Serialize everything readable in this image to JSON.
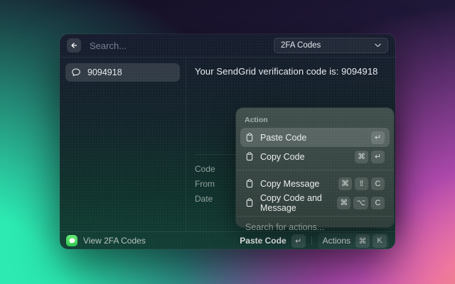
{
  "topbar": {
    "search_placeholder": "Search...",
    "dropdown_label": "2FA Codes"
  },
  "sidebar": {
    "items": [
      {
        "icon": "chat-bubble-icon",
        "label": "9094918",
        "selected": true
      }
    ]
  },
  "detail": {
    "message": "Your SendGrid verification code is: 9094918",
    "metadata_labels": [
      "Code",
      "From",
      "Date"
    ]
  },
  "action_menu": {
    "section_title": "Action",
    "items": [
      {
        "icon": "clipboard-icon",
        "label": "Paste Code",
        "keys": [
          "↵"
        ],
        "selected": true
      },
      {
        "icon": "clipboard-icon",
        "label": "Copy Code",
        "keys": [
          "⌘",
          "↵"
        ],
        "selected": false
      },
      {
        "icon": "clipboard-icon",
        "label": "Copy Message",
        "keys": [
          "⌘",
          "⇧",
          "C"
        ],
        "selected": false
      },
      {
        "icon": "clipboard-icon",
        "label": "Copy Code and Message",
        "keys": [
          "⌘",
          "⌥",
          "C"
        ],
        "selected": false
      }
    ],
    "search_placeholder": "Search for actions..."
  },
  "statusbar": {
    "app_icon": "green-messages-icon",
    "app_label": "View 2FA Codes",
    "primary_action_label": "Paste Code",
    "primary_action_key": "↵",
    "actions_label": "Actions",
    "actions_keys": [
      "⌘",
      "K"
    ]
  },
  "colors": {
    "bg_teal": "#2ceab2",
    "bg_pink": "#ec5ad4",
    "bg_orange": "#f79e5e",
    "bg_dark_purple": "#201838",
    "app_icon_green": "#2cc84d"
  }
}
